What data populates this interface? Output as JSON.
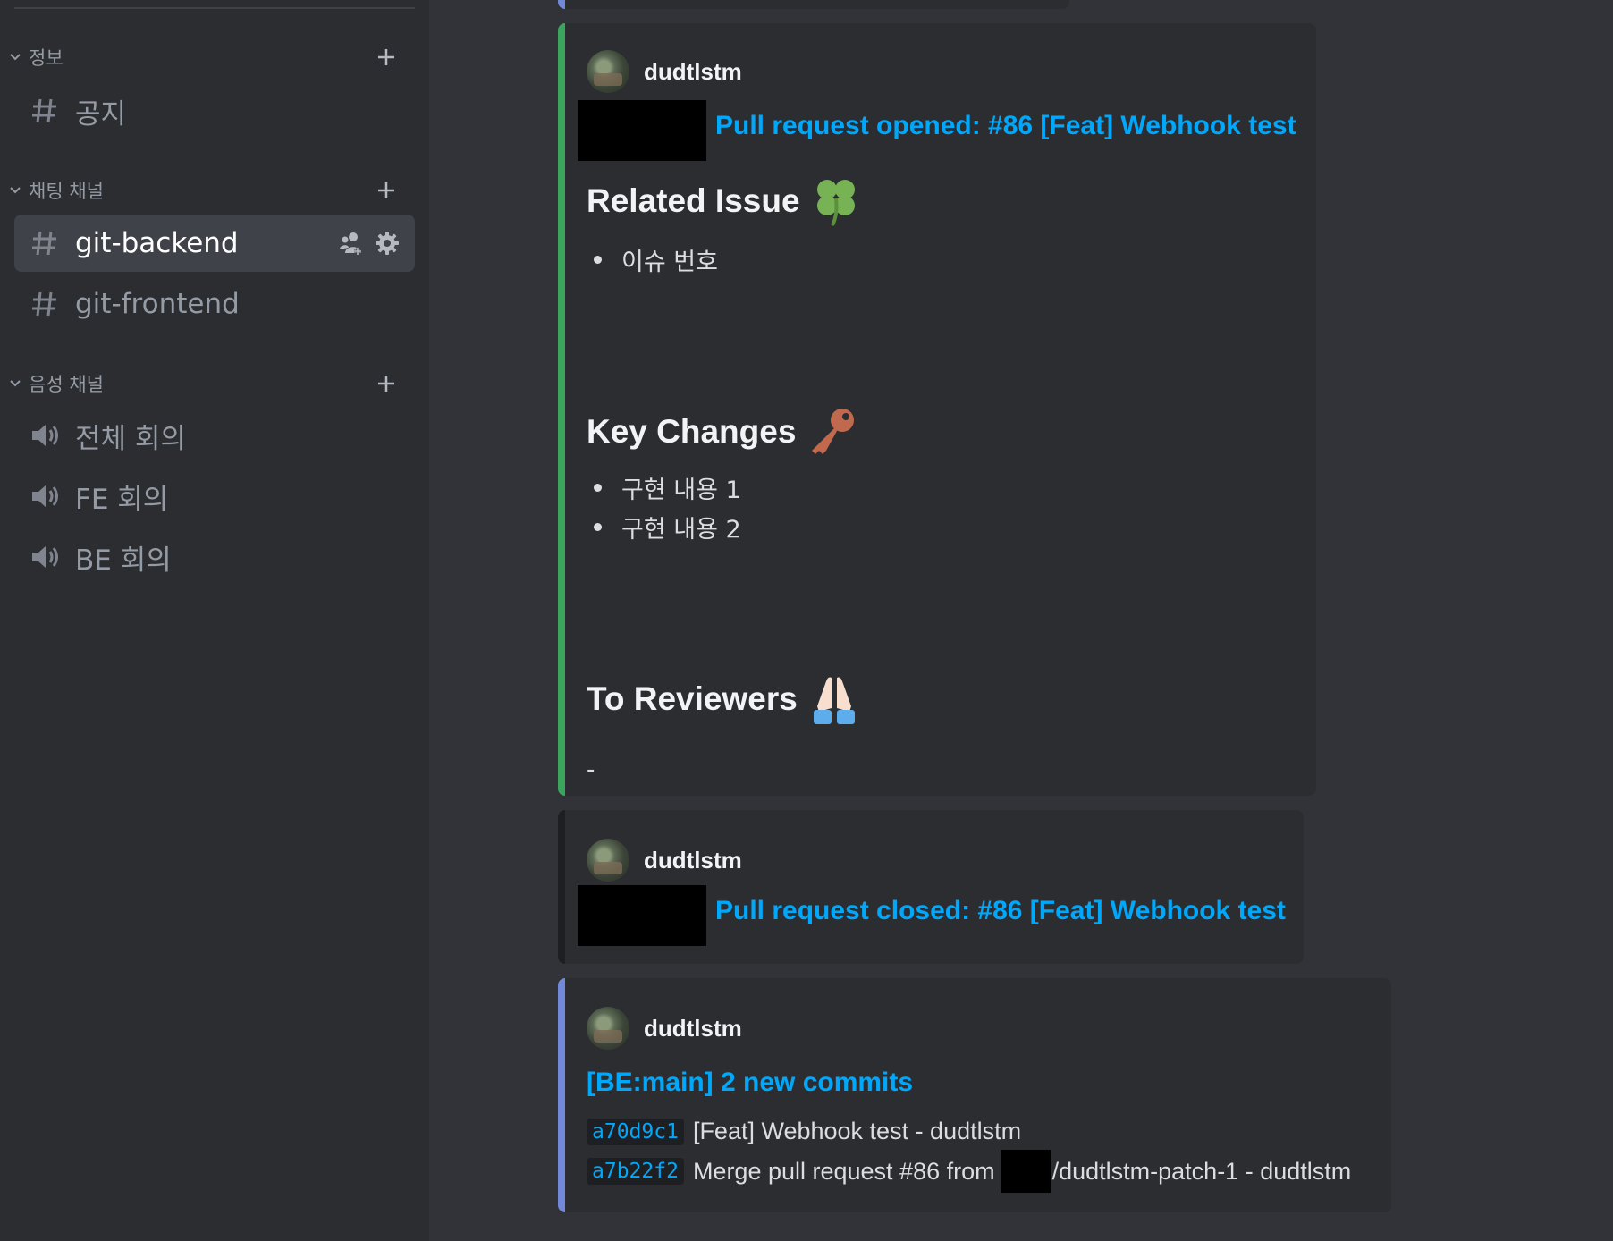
{
  "sidebar": {
    "categories": [
      {
        "label": "정보",
        "channels": [
          {
            "label": "공지",
            "type": "text"
          }
        ]
      },
      {
        "label": "채팅 채널",
        "channels": [
          {
            "label": "git-backend",
            "type": "text",
            "active": true
          },
          {
            "label": "git-frontend",
            "type": "text"
          }
        ]
      },
      {
        "label": "음성 채널",
        "channels": [
          {
            "label": "전체 회의",
            "type": "voice"
          },
          {
            "label": "FE 회의",
            "type": "voice"
          },
          {
            "label": "BE 회의",
            "type": "voice"
          }
        ]
      }
    ]
  },
  "messages": [
    {
      "author": "dudtlstm",
      "accent": "#3ba55d",
      "title": "Pull request opened: #86 [Feat] Webhook test",
      "sections": [
        {
          "heading": "Related Issue",
          "emoji": "four-leaf-clover",
          "bullets": [
            "이슈 번호"
          ]
        },
        {
          "heading": "Key Changes",
          "emoji": "key",
          "bullets": [
            "구현 내용 1",
            "구현 내용 2"
          ]
        },
        {
          "heading": "To Reviewers",
          "emoji": "folded-hands",
          "text": "-"
        }
      ]
    },
    {
      "author": "dudtlstm",
      "accent": "#1e1f22",
      "title": "Pull request closed: #86 [Feat] Webhook test"
    },
    {
      "author": "dudtlstm",
      "accent": "#7289da",
      "title": "[BE:main] 2 new commits",
      "commits": [
        {
          "hash": "a70d9c1",
          "message": "[Feat] Webhook test - dudtlstm"
        },
        {
          "hash": "a7b22f2",
          "message_prefix": "Merge pull request #86 from",
          "message_suffix": "/dudtlstm-patch-1 - dudtlstm"
        }
      ]
    }
  ],
  "colors": {
    "link": "#00a8fc",
    "background": "#313338",
    "sidebar": "#2b2d31"
  }
}
